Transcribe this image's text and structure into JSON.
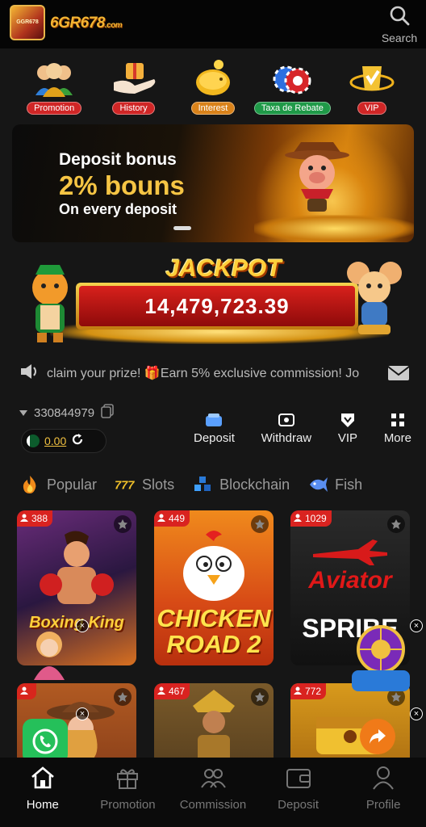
{
  "header": {
    "logo_text": "6GR678",
    "logo_suffix": ".com",
    "badge_text": "GGR678",
    "search_label": "Search"
  },
  "quicknav": [
    {
      "label": "Promotion",
      "icon": "people-icon",
      "style": "red"
    },
    {
      "label": "History",
      "icon": "gift-hand-icon",
      "style": "red"
    },
    {
      "label": "Interest",
      "icon": "piggy-bank-icon",
      "style": "orange"
    },
    {
      "label": "Taxa de Rebate",
      "icon": "chips-icon",
      "style": "green"
    },
    {
      "label": "VIP",
      "icon": "vip-badge-icon",
      "style": "red"
    }
  ],
  "banner": {
    "line1": "Deposit bonus",
    "line2": "2% bouns",
    "line3": "On every deposit"
  },
  "jackpot": {
    "title": "JACKPOT",
    "value": "14,479,723.39"
  },
  "marquee": {
    "text": "claim your prize! 🎁Earn 5% exclusive commission! Jo"
  },
  "account": {
    "user_id": "330844979",
    "balance": "0.00"
  },
  "actions": [
    {
      "label": "Deposit",
      "icon": "deposit-icon"
    },
    {
      "label": "Withdraw",
      "icon": "withdraw-icon"
    },
    {
      "label": "VIP",
      "icon": "vip-shield-icon"
    },
    {
      "label": "More",
      "icon": "grid-icon"
    }
  ],
  "categories": [
    {
      "label": "Popular",
      "icon": "fire-icon"
    },
    {
      "label": "Slots",
      "icon": "777-icon"
    },
    {
      "label": "Blockchain",
      "icon": "cubes-icon"
    },
    {
      "label": "Fish",
      "icon": "fish-icon"
    }
  ],
  "games": [
    {
      "count": "388",
      "name": "Boxing King"
    },
    {
      "count": "449",
      "name": "CHICKEN ROAD 2"
    },
    {
      "count": "1029",
      "name1": "Aviator",
      "name2": "SPRIBE"
    },
    {
      "count": "",
      "name": ""
    },
    {
      "count": "467",
      "name": ""
    },
    {
      "count": "772",
      "name": ""
    }
  ],
  "bottom_nav": [
    {
      "label": "Home",
      "icon": "home-icon",
      "active": true
    },
    {
      "label": "Promotion",
      "icon": "gift-icon"
    },
    {
      "label": "Commission",
      "icon": "users-icon"
    },
    {
      "label": "Deposit",
      "icon": "wallet-icon"
    },
    {
      "label": "Profile",
      "icon": "person-icon"
    }
  ],
  "colors": {
    "background": "#161616",
    "accent_gold": "#f3b533",
    "badge_red": "#d92320"
  }
}
